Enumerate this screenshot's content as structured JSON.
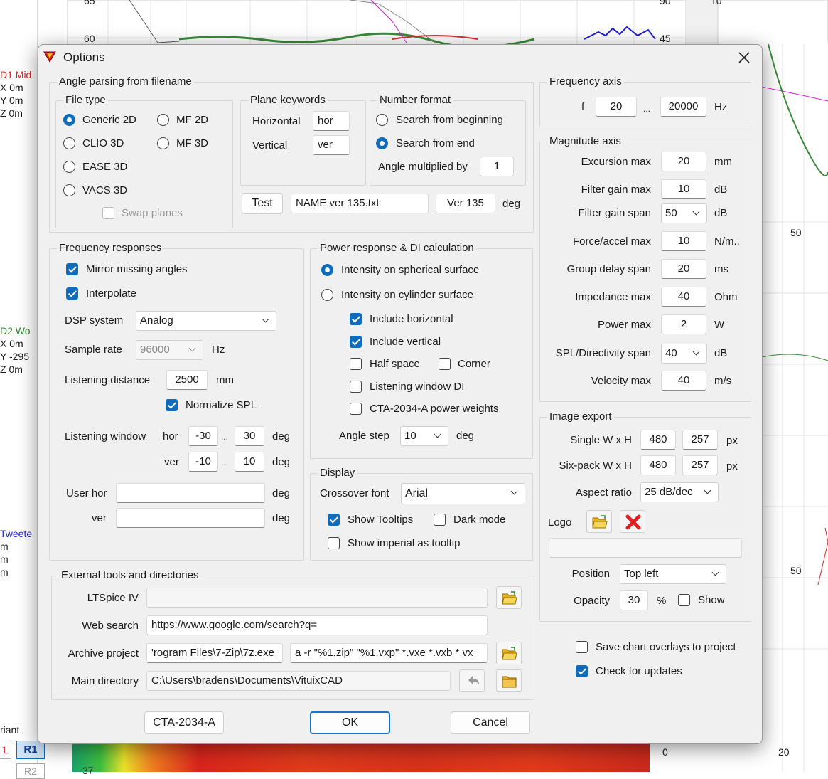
{
  "background": {
    "y_ticks_left": [
      "65",
      "60"
    ],
    "y_ticks_right": [
      "90",
      "45"
    ],
    "y_tick_far_right": "10",
    "right_panel_ticks": [
      "50",
      "50",
      "20"
    ],
    "bottom_panel_ticks": [
      "0",
      "37"
    ],
    "driver1": {
      "name": "D1 Mid",
      "x": "X 0m",
      "y": "Y 0m",
      "z": "Z 0m"
    },
    "driver2": {
      "name": "D2 Wo",
      "x": "X 0m",
      "y": "Y -295",
      "z": "Z 0m"
    },
    "driver3": {
      "name": "Tweete",
      "lines": [
        "m",
        "m",
        "m"
      ]
    },
    "variant_label": "riant",
    "variant_buttons": [
      "1",
      "R1",
      "R2"
    ],
    "colors": {
      "driver1": "#e02020",
      "driver2": "#2a8a2a",
      "driver3": "#2020d0",
      "accent": "#0f6cbd"
    }
  },
  "dialog": {
    "title": "Options",
    "close_icon": "close-icon",
    "angle_parsing": {
      "title": "Angle parsing from filename",
      "file_type": {
        "title": "File type",
        "options": [
          "Generic 2D",
          "MF 2D",
          "CLIO 3D",
          "MF 3D",
          "EASE 3D",
          "VACS 3D"
        ],
        "selected": "Generic 2D",
        "swap_planes": "Swap planes"
      },
      "plane_keywords": {
        "title": "Plane keywords",
        "horizontal_label": "Horizontal",
        "horizontal_value": "hor",
        "vertical_label": "Vertical",
        "vertical_value": "ver"
      },
      "number_format": {
        "title": "Number format",
        "search_beginning": "Search from beginning",
        "search_end": "Search from end",
        "angle_mult_label": "Angle multiplied by",
        "angle_mult_value": "1"
      },
      "test_button": "Test",
      "test_name": "NAME ver 135.txt",
      "test_result": "Ver 135",
      "test_unit": "deg"
    },
    "frequency_responses": {
      "title": "Frequency responses",
      "mirror": "Mirror missing angles",
      "interpolate": "Interpolate",
      "dsp_label": "DSP system",
      "dsp_value": "Analog",
      "sample_rate_label": "Sample rate",
      "sample_rate_value": "96000",
      "sample_rate_unit": "Hz",
      "listening_distance_label": "Listening distance",
      "listening_distance_value": "2500",
      "listening_distance_unit": "mm",
      "normalize_spl": "Normalize SPL",
      "listening_window_label": "Listening window",
      "hor_label": "hor",
      "hor_min": "-30",
      "hor_max": "30",
      "ver_label": "ver",
      "ver_min": "-10",
      "ver_max": "10",
      "range_sep": "...",
      "deg": "deg",
      "user_hor_label": "User hor",
      "user_hor_value": "",
      "user_ver_label": "ver",
      "user_ver_value": ""
    },
    "power_response": {
      "title": "Power response & DI calculation",
      "spherical": "Intensity on spherical surface",
      "cylinder": "Intensity on cylinder surface",
      "include_horizontal": "Include horizontal",
      "include_vertical": "Include vertical",
      "half_space": "Half space",
      "corner": "Corner",
      "listening_window_di": "Listening window DI",
      "cta_weights": "CTA-2034-A power weights",
      "angle_step_label": "Angle step",
      "angle_step_value": "10",
      "angle_step_unit": "deg"
    },
    "display": {
      "title": "Display",
      "crossover_font_label": "Crossover font",
      "crossover_font_value": "Arial",
      "show_tooltips": "Show Tooltips",
      "dark_mode": "Dark mode",
      "show_imperial": "Show imperial as tooltip"
    },
    "frequency_axis": {
      "title": "Frequency axis",
      "f_label": "f",
      "f_min": "20",
      "sep": "...",
      "f_max": "20000",
      "unit": "Hz"
    },
    "magnitude_axis": {
      "title": "Magnitude axis",
      "rows": [
        {
          "label": "Excursion max",
          "value": "20",
          "unit": "mm",
          "kind": "text"
        },
        {
          "label": "Filter gain max",
          "value": "10",
          "unit": "dB",
          "kind": "text"
        },
        {
          "label": "Filter gain span",
          "value": "50",
          "unit": "dB",
          "kind": "combo"
        },
        {
          "label": "Force/accel max",
          "value": "10",
          "unit": "N/m..",
          "kind": "text"
        },
        {
          "label": "Group delay span",
          "value": "20",
          "unit": "ms",
          "kind": "text"
        },
        {
          "label": "Impedance max",
          "value": "40",
          "unit": "Ohm",
          "kind": "text"
        },
        {
          "label": "Power max",
          "value": "2",
          "unit": "W",
          "kind": "text"
        },
        {
          "label": "SPL/Directivity span",
          "value": "40",
          "unit": "dB",
          "kind": "combo"
        },
        {
          "label": "Velocity max",
          "value": "40",
          "unit": "m/s",
          "kind": "text"
        }
      ]
    },
    "image_export": {
      "title": "Image export",
      "single_label": "Single W x H",
      "single_w": "480",
      "single_h": "257",
      "sixpack_label": "Six-pack W x H",
      "sixpack_w": "480",
      "sixpack_h": "257",
      "px": "px",
      "aspect_label": "Aspect ratio",
      "aspect_value": "25 dB/dec",
      "logo_label": "Logo",
      "logo_path": "",
      "position_label": "Position",
      "position_value": "Top left",
      "opacity_label": "Opacity",
      "opacity_value": "30",
      "opacity_unit": "%",
      "show": "Show"
    },
    "save_overlays": "Save chart overlays to project",
    "check_updates": "Check for updates",
    "external_tools": {
      "title": "External tools and directories",
      "ltspice_label": "LTSpice IV",
      "ltspice_value": "",
      "web_search_label": "Web search",
      "web_search_value": "https://www.google.com/search?q=",
      "archive_label": "Archive project",
      "archive_path": "'rogram Files\\7-Zip\\7z.exe",
      "archive_args": "a -r \"%1.zip\" \"%1.vxp\" *.vxe *.vxb *.vx",
      "main_dir_label": "Main directory",
      "main_dir_value": "C:\\Users\\bradens\\Documents\\VituixCAD"
    },
    "buttons": {
      "cta": "CTA-2034-A",
      "ok": "OK",
      "cancel": "Cancel"
    }
  }
}
